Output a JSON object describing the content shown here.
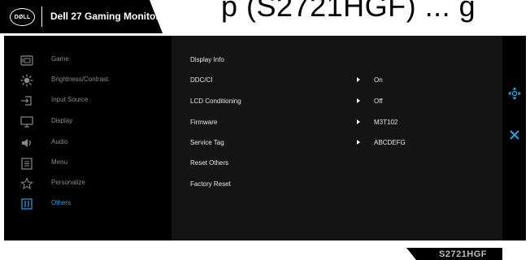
{
  "header": {
    "logo_text": "DØLL",
    "title": "Dell 27 Gaming Monitor",
    "background_text": "p (S2721HGF) ... g"
  },
  "menu": {
    "items": [
      {
        "label": "Game",
        "icon": "game-icon"
      },
      {
        "label": "Brightness/Contrast",
        "icon": "brightness-icon"
      },
      {
        "label": "Input Source",
        "icon": "input-source-icon"
      },
      {
        "label": "Display",
        "icon": "display-icon"
      },
      {
        "label": "Audio",
        "icon": "audio-icon"
      },
      {
        "label": "Menu",
        "icon": "menu-icon"
      },
      {
        "label": "Personalize",
        "icon": "star-icon"
      },
      {
        "label": "Others",
        "icon": "others-icon"
      }
    ],
    "active_index": 7
  },
  "others": {
    "rows": [
      {
        "label": "Display Info",
        "value": ""
      },
      {
        "label": "DDC/CI",
        "value": "On"
      },
      {
        "label": "LCD Conditioning",
        "value": "Off"
      },
      {
        "label": "Firmware",
        "value": "M3T102"
      },
      {
        "label": "Service Tag",
        "value": "ABCDEFG"
      },
      {
        "label": "Reset Others",
        "value": ""
      },
      {
        "label": "Factory Reset",
        "value": ""
      }
    ]
  },
  "nav": {
    "move_icon": "joystick-move-icon",
    "exit_icon": "close-icon"
  },
  "footer": {
    "model": "S2721HGF"
  },
  "colors": {
    "active": "#2aa3e6",
    "text": "#e6e6e6",
    "muted": "#8a8a8a",
    "panel": "#000000",
    "content_panel": "#141414"
  }
}
